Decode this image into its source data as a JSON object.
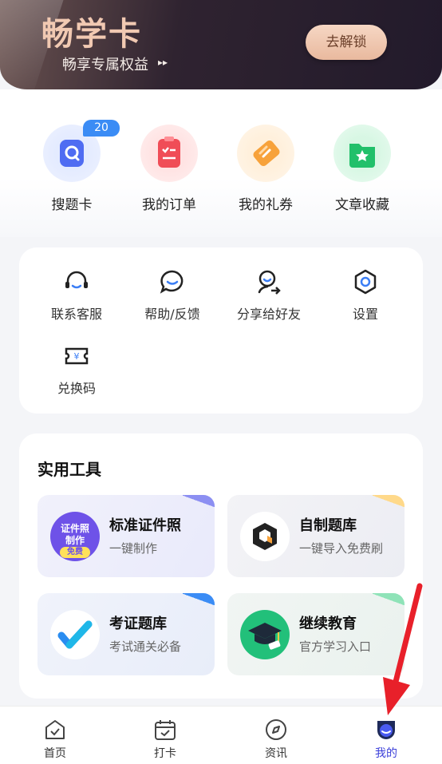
{
  "banner": {
    "title": "畅学卡",
    "subtitle": "畅享专属权益",
    "arrow": "▸▸",
    "unlock_label": "去解锁"
  },
  "quick": {
    "badge": "20",
    "items": [
      {
        "label": "搜题卡",
        "icon": "search-card-icon"
      },
      {
        "label": "我的订单",
        "icon": "order-list-icon"
      },
      {
        "label": "我的礼券",
        "icon": "coupon-icon"
      },
      {
        "label": "文章收藏",
        "icon": "star-folder-icon"
      }
    ]
  },
  "services": {
    "items": [
      {
        "label": "联系客服",
        "icon": "headset-icon"
      },
      {
        "label": "帮助/反馈",
        "icon": "chat-bubble-icon"
      },
      {
        "label": "分享给好友",
        "icon": "share-user-icon"
      },
      {
        "label": "设置",
        "icon": "settings-hex-icon"
      },
      {
        "label": "兑换码",
        "icon": "yen-ticket-icon"
      }
    ]
  },
  "tools": {
    "title": "实用工具",
    "items": [
      {
        "title": "标准证件照",
        "desc": "一键制作",
        "icon_text_1": "证件照",
        "icon_text_2": "制作",
        "icon_tag": "免费"
      },
      {
        "title": "自制题库",
        "desc": "一键导入免费刷"
      },
      {
        "title": "考证题库",
        "desc": "考试通关必备"
      },
      {
        "title": "继续教育",
        "desc": "官方学习入口"
      }
    ]
  },
  "nav": {
    "items": [
      {
        "label": "首页",
        "icon": "home-icon"
      },
      {
        "label": "打卡",
        "icon": "calendar-check-icon"
      },
      {
        "label": "资讯",
        "icon": "compass-icon"
      },
      {
        "label": "我的",
        "icon": "profile-icon"
      }
    ],
    "active_index": 3,
    "active_color": "#3b3fd9"
  }
}
